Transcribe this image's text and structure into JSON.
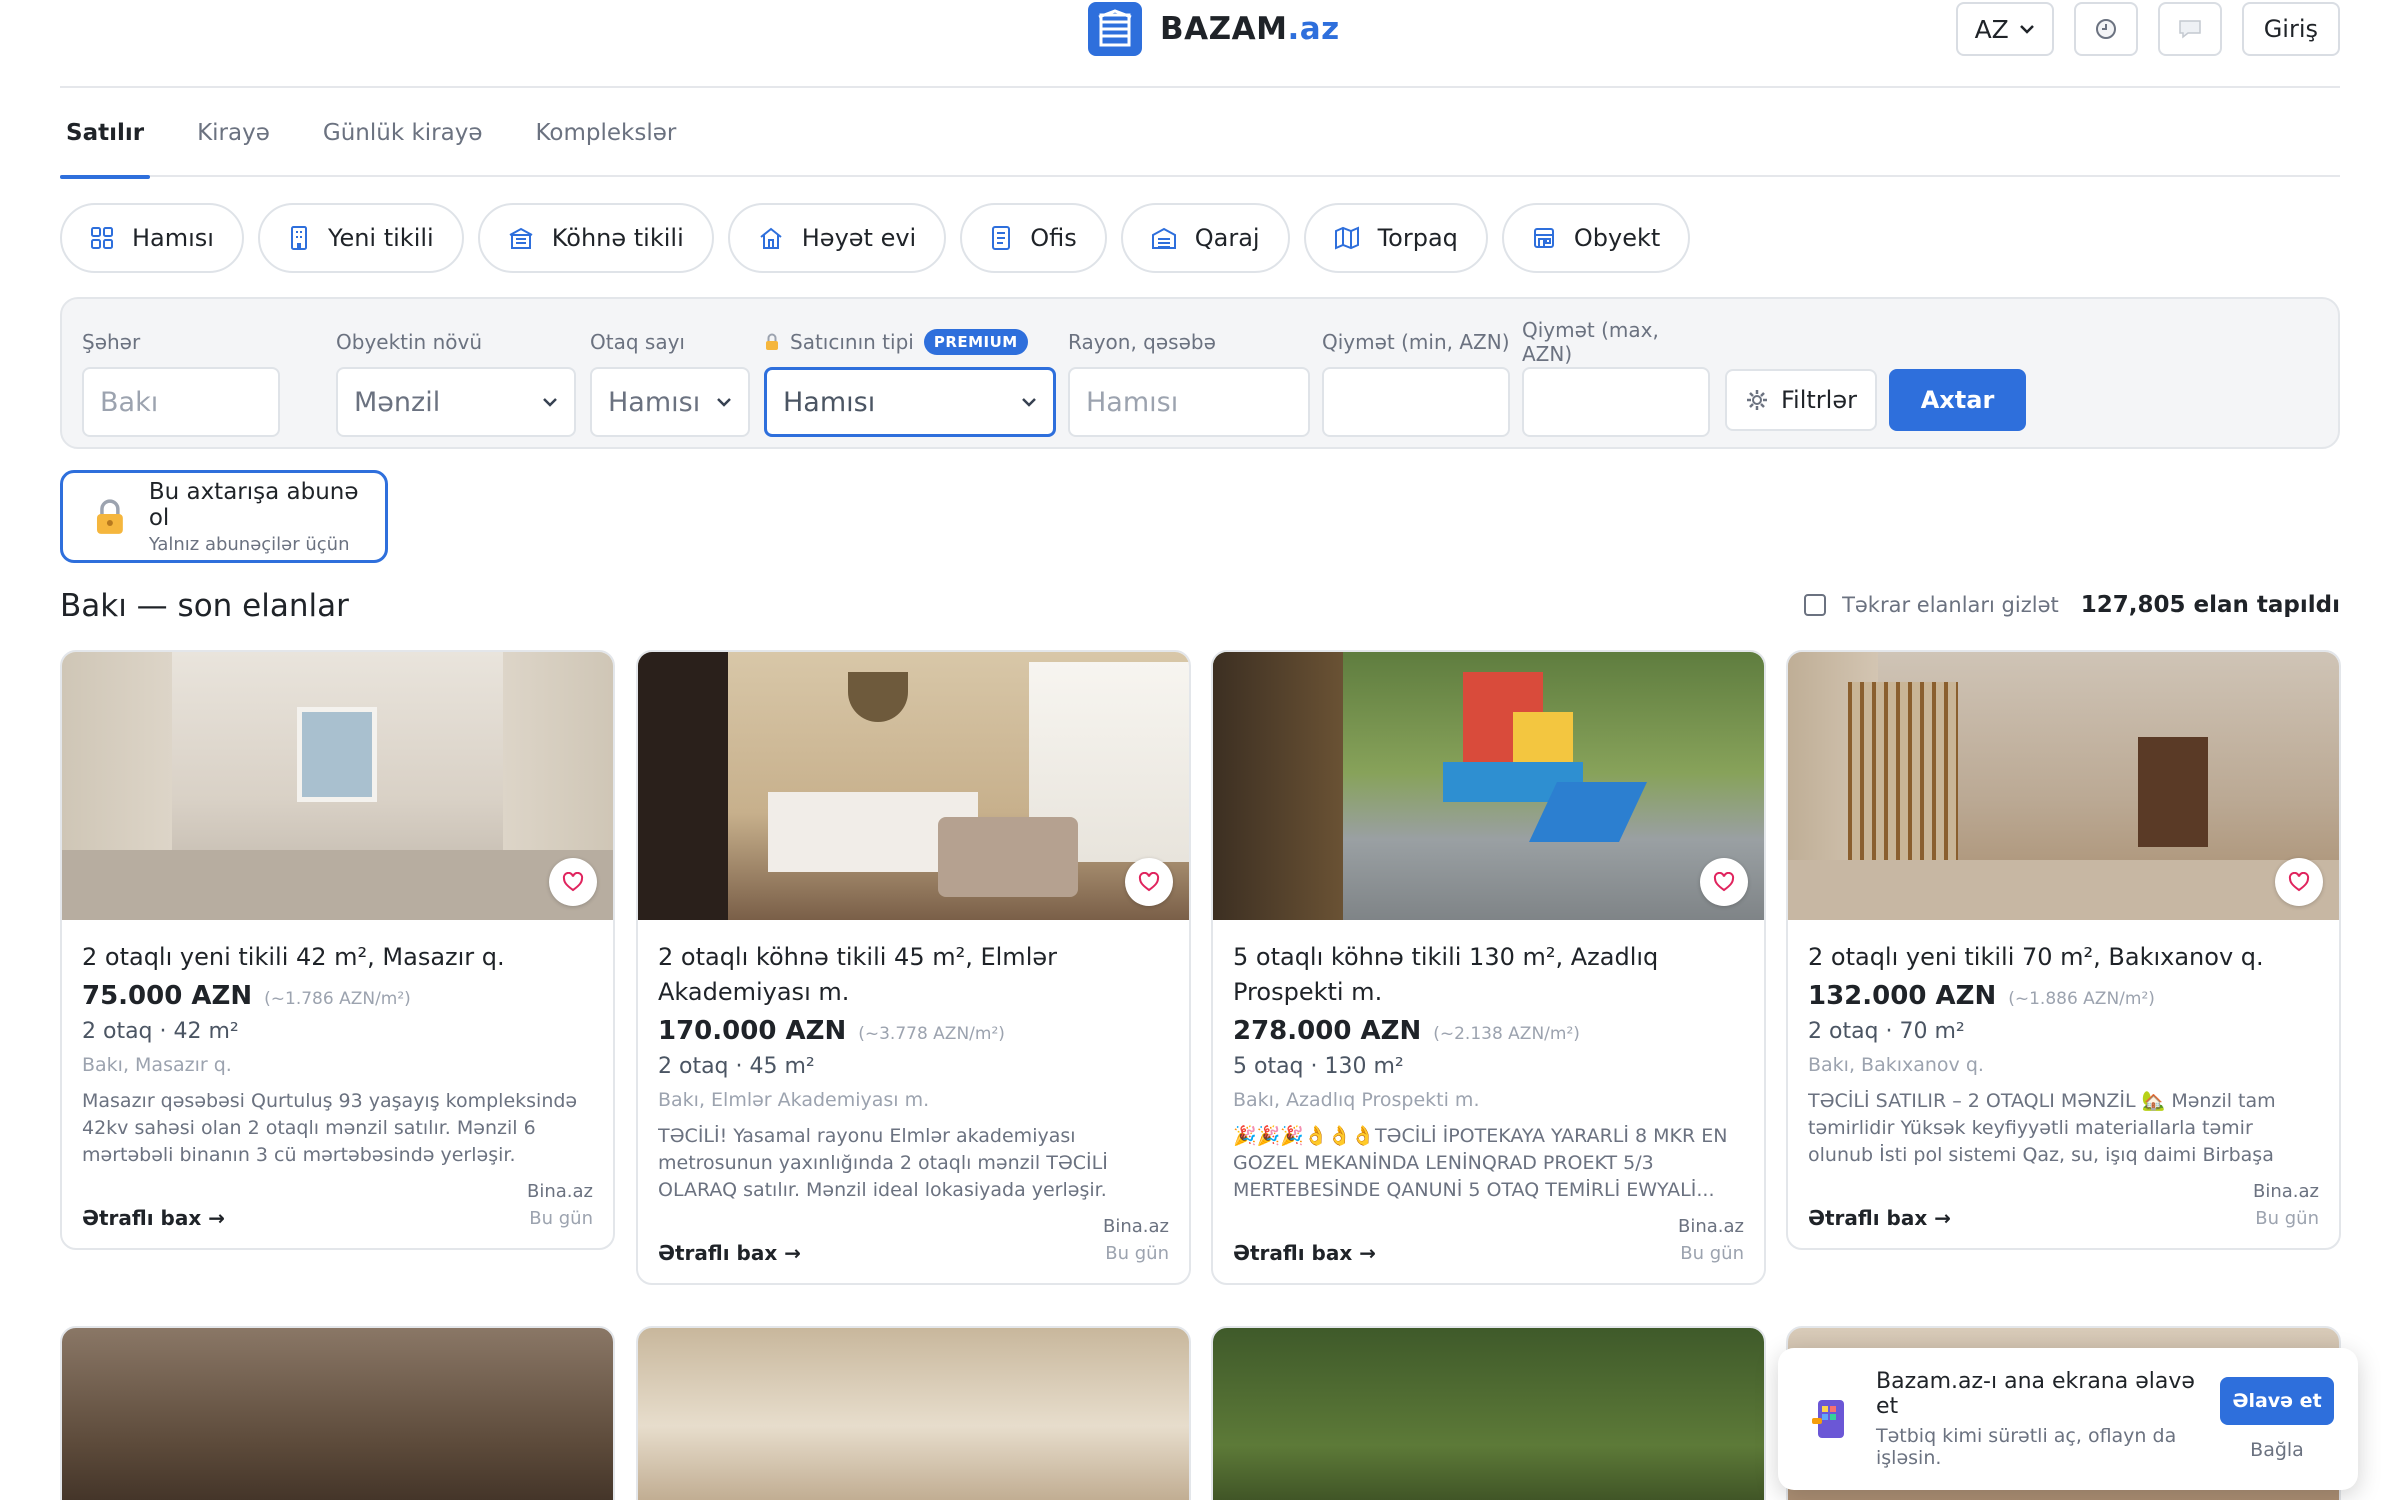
{
  "header": {
    "brand": "BAZAM",
    "brand_tld": ".az",
    "lang": "AZ",
    "history_icon": "clock-icon",
    "messages_icon": "chat-bubble-icon",
    "login": "Giriş"
  },
  "tabs": [
    {
      "label": "Satılır",
      "active": true
    },
    {
      "label": "Kirayə"
    },
    {
      "label": "Günlük kirayə"
    },
    {
      "label": "Komplekslər"
    }
  ],
  "categories": [
    {
      "label": "Hamısı",
      "icon": "grid-icon"
    },
    {
      "label": "Yeni tikili",
      "icon": "building-icon"
    },
    {
      "label": "Köhnə tikili",
      "icon": "old-building-icon"
    },
    {
      "label": "Həyət evi",
      "icon": "house-icon"
    },
    {
      "label": "Ofis",
      "icon": "office-icon"
    },
    {
      "label": "Qaraj",
      "icon": "garage-icon"
    },
    {
      "label": "Torpaq",
      "icon": "map-icon"
    },
    {
      "label": "Obyekt",
      "icon": "store-icon"
    }
  ],
  "filters": {
    "city": {
      "label": "Şəhər",
      "placeholder": "Bakı"
    },
    "object_type": {
      "label": "Obyektin növü",
      "value": "Mənzil"
    },
    "rooms": {
      "label": "Otaq sayı",
      "value": "Hamısı"
    },
    "seller": {
      "label": "Satıcının tipi",
      "badge": "PREMIUM",
      "value": "Hamısı"
    },
    "district": {
      "label": "Rayon, qəsəbə",
      "placeholder": "Hamısı"
    },
    "price_min": {
      "label": "Qiymət (min, AZN)",
      "value": ""
    },
    "price_max": {
      "label": "Qiymət (max, AZN)",
      "value": ""
    },
    "more_filters": "Filtrlər",
    "search": "Axtar"
  },
  "subscribe": {
    "title": "Bu axtarışa abunə ol",
    "subtitle": "Yalnız abunəçilər üçün"
  },
  "section": {
    "title": "Bakı — son elanlar",
    "hide_duplicates": "Təkrar elanları gizlət",
    "count": "127,805 elan tapıldı"
  },
  "listings": [
    {
      "title": "2 otaqlı yeni tikili 42 m², Masazır q.",
      "price": "75.000 AZN",
      "per_m2": "(~1.786 AZN/m²)",
      "meta": "2 otaq · 42 m²",
      "location": "Bakı, Masazır q.",
      "description": "Masazır qəsəbəsi Qurtuluş 93 yaşayış kompleksində 42kv sahəsi olan 2 otaqlı mənzil satılır. Mənzil 6 mərtəbəli binanın 3 cü mərtəbəsində yerləşir. Mənzilin kupçası var...",
      "source": "Bina.az",
      "more": "Ətraflı bax →",
      "date": "Bu gün"
    },
    {
      "title": "2 otaqlı köhnə tikili 45 m², Elmlər Akademiyası m.",
      "price": "170.000 AZN",
      "per_m2": "(~3.778 AZN/m²)",
      "meta": "2 otaq · 45 m²",
      "location": "Bakı, Elmlər Akademiyası m.",
      "description": "TƏCİLİ! Yasamal rayonu Elmlər akademiyası metrosunun yaxınlığında 2 otaqlı mənzil TƏCİLİ OLARAQ satılır. Mənzil ideal lokasiyada yerləşir. Mənzilin mərkəzi istilik sistemi...",
      "source": "Bina.az",
      "more": "Ətraflı bax →",
      "date": "Bu gün"
    },
    {
      "title": "5 otaqlı köhnə tikili 130 m², Azadlıq Prospekti m.",
      "price": "278.000 AZN",
      "per_m2": "(~2.138 AZN/m²)",
      "meta": "5 otaq · 130 m²",
      "location": "Bakı, Azadlıq Prospekti m.",
      "description": "🎉🎉🎉👌👌👌TƏCİLİ İPOTEKAYA YARARLİ 8 MKR EN GOZEL MEKANİNDA LENİNQRAD PROEKT 5/3 MERTEBESİNDE QANUNİ 5 OTAQ TEMİRLİ EWYALİ...",
      "source": "Bina.az",
      "more": "Ətraflı bax →",
      "date": "Bu gün"
    },
    {
      "title": "2 otaqlı yeni tikili 70 m², Bakıxanov q.",
      "price": "132.000 AZN",
      "per_m2": "(~1.886 AZN/m²)",
      "meta": "2 otaq · 70 m²",
      "location": "Bakı, Bakıxanov q.",
      "description": "TƏCİLİ SATILIR – 2 OTAQLI MƏNZİL 🏡 Mənzil tam təmirlidir Yüksək keyfiyyətli materiallarla təmir olunub İsti pol sistemi Qaz, su, işıq daimi Birbaşa Heydər Əliyev...",
      "source": "Bina.az",
      "more": "Ətraflı bax →",
      "date": "Bu gün"
    }
  ],
  "install_prompt": {
    "title": "Bazam.az-ı ana ekrana əlavə et",
    "subtitle": "Tətbiq kimi sürətli aç, oflayn da işləsin.",
    "add": "Əlavə et",
    "close": "Bağla"
  }
}
